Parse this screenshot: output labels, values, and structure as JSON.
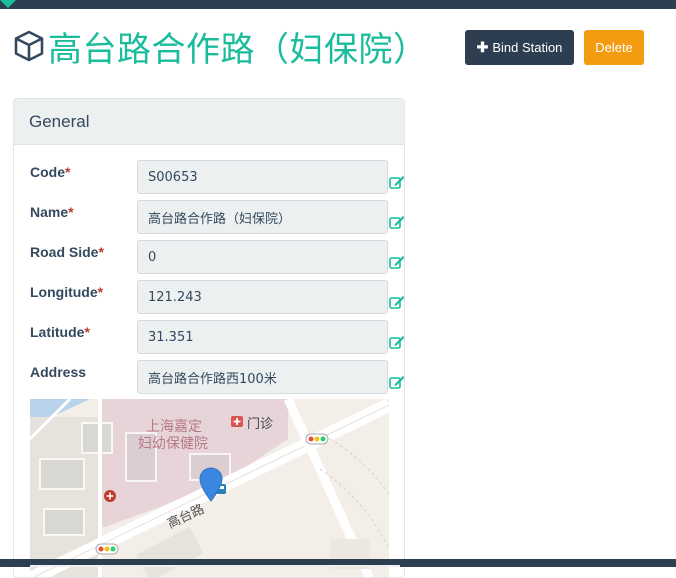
{
  "header": {
    "title": "高台路合作路（妇保院）",
    "icon": "cube-icon"
  },
  "actions": {
    "bind_station_label": "Bind Station",
    "delete_label": "Delete"
  },
  "panel": {
    "heading": "General",
    "required_marker": "*",
    "fields": [
      {
        "label": "Code",
        "required": true,
        "value": "S00653"
      },
      {
        "label": "Name",
        "required": true,
        "value": "高台路合作路（妇保院）"
      },
      {
        "label": "Road Side",
        "required": true,
        "value": "0"
      },
      {
        "label": "Longitude",
        "required": true,
        "value": "121.243"
      },
      {
        "label": "Latitude",
        "required": true,
        "value": "31.351"
      },
      {
        "label": "Address",
        "required": false,
        "value": "高台路合作路西100米"
      }
    ]
  },
  "map": {
    "poi_line1": "上海嘉定",
    "poi_line2": "妇幼保健院",
    "clinic_label": "门诊",
    "road_label": "高台路"
  },
  "colors": {
    "accent": "#1abc9c",
    "dark": "#2c3e50",
    "warning": "#f39c12",
    "required": "#c0392b",
    "pin": "#3a86e0"
  }
}
